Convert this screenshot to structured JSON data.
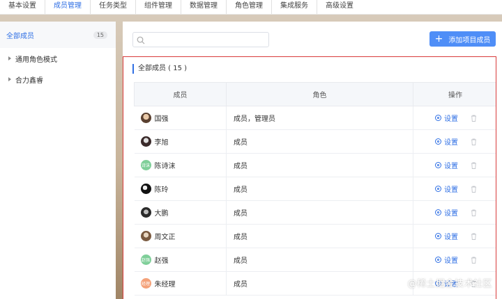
{
  "topnav": {
    "tabs": [
      {
        "label": "基本设置"
      },
      {
        "label": "成员管理",
        "active": true
      },
      {
        "label": "任务类型"
      },
      {
        "label": "组件管理"
      },
      {
        "label": "数据管理"
      },
      {
        "label": "角色管理"
      },
      {
        "label": "集成服务"
      },
      {
        "label": "高级设置"
      }
    ],
    "accent": "#2f6fe4"
  },
  "sidebar": {
    "all_label": "全部成员",
    "all_count": "15",
    "groups": [
      {
        "label": "通用角色模式"
      },
      {
        "label": "合力鑫睿"
      }
    ]
  },
  "search": {
    "placeholder": "",
    "icon": "search-icon"
  },
  "add_button": {
    "label": "添加项目成员",
    "icon": "plus-icon",
    "color": "#4f8ef7"
  },
  "panel": {
    "title": "全部成员 ( 15 )"
  },
  "table": {
    "headers": {
      "member": "成员",
      "role": "角色",
      "actions": "操作"
    },
    "rows": [
      {
        "name": "国强",
        "role": "成员，管理员",
        "avatar": "photo1",
        "action": "设置"
      },
      {
        "name": "李旭",
        "role": "成员",
        "avatar": "photo2",
        "action": "设置"
      },
      {
        "name": "陈诗沫",
        "role": "成员",
        "avatar": "green",
        "avatar_text": "诗沫",
        "action": "设置"
      },
      {
        "name": "陈玲",
        "role": "成员",
        "avatar": "photo3",
        "action": "设置"
      },
      {
        "name": "大鹏",
        "role": "成员",
        "avatar": "photo4",
        "action": "设置"
      },
      {
        "name": "周文正",
        "role": "成员",
        "avatar": "photo5",
        "action": "设置"
      },
      {
        "name": "赵强",
        "role": "成员",
        "avatar": "green",
        "avatar_text": "赵强",
        "action": "设置"
      },
      {
        "name": "朱经理",
        "role": "成员",
        "avatar": "orange",
        "avatar_text": "经理",
        "action": "设置"
      }
    ]
  },
  "watermark": "@稀土掘金技术社区"
}
